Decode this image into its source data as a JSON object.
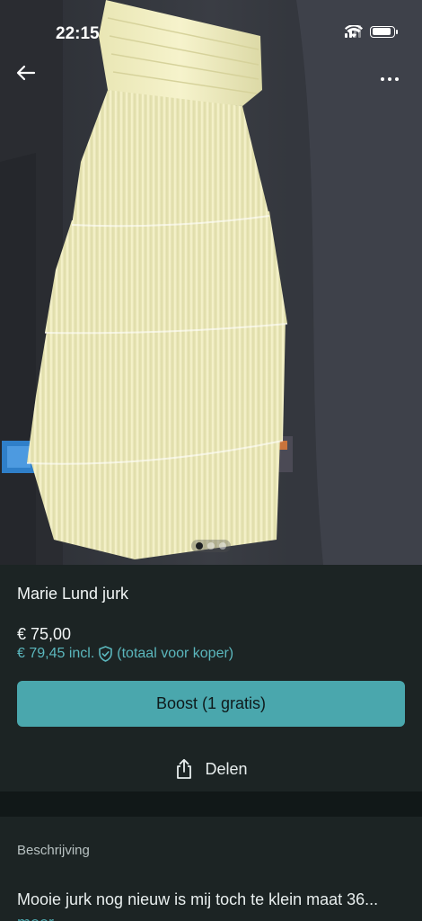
{
  "status_bar": {
    "time": "22:15"
  },
  "photo": {
    "pager": {
      "total": 3,
      "active_index": 0
    }
  },
  "listing": {
    "title": "Marie Lund jurk",
    "price": "€ 75,00",
    "price_incl": "€ 79,45 incl.",
    "price_incl_note": "(totaal voor koper)"
  },
  "actions": {
    "boost_label": "Boost (1 gratis)",
    "share_label": "Delen"
  },
  "description": {
    "label": "Beschrijving",
    "text": "Mooie jurk nog nieuw is mij toch te klein maat 36...",
    "more_label": "meer"
  },
  "colors": {
    "accent": "#4aa7ad",
    "link": "#5bb7bd",
    "background": "#1c2424",
    "dress": "#f2efc2"
  },
  "icons": {
    "back": "arrow-left-icon",
    "more": "more-horizontal-icon",
    "shield": "shield-check-icon",
    "share": "share-icon"
  }
}
